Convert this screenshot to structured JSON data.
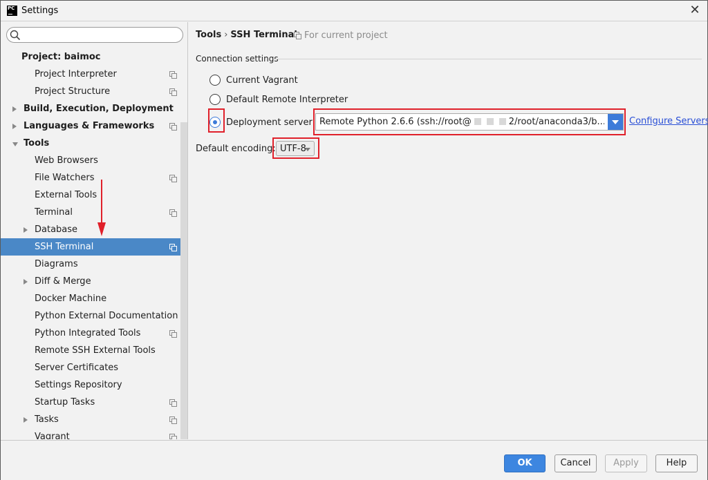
{
  "window": {
    "title": "Settings",
    "app_icon_text": "PC"
  },
  "search": {
    "placeholder": "",
    "icon": "search-icon"
  },
  "sidebar": {
    "items": [
      {
        "label": "Project: baimoc",
        "indent": 30,
        "bold": true,
        "arrow": "none",
        "copy": false,
        "selected": false
      },
      {
        "label": "Project Interpreter",
        "indent": 49,
        "bold": false,
        "arrow": "none",
        "copy": true,
        "selected": false
      },
      {
        "label": "Project Structure",
        "indent": 49,
        "bold": false,
        "arrow": "none",
        "copy": true,
        "selected": false
      },
      {
        "label": "Build, Execution, Deployment",
        "indent": 33,
        "bold": true,
        "arrow": "right",
        "copy": false,
        "selected": false
      },
      {
        "label": "Languages & Frameworks",
        "indent": 33,
        "bold": true,
        "arrow": "right",
        "copy": true,
        "selected": false
      },
      {
        "label": "Tools",
        "indent": 33,
        "bold": true,
        "arrow": "down",
        "copy": false,
        "selected": false
      },
      {
        "label": "Web Browsers",
        "indent": 49,
        "bold": false,
        "arrow": "none",
        "copy": false,
        "selected": false
      },
      {
        "label": "File Watchers",
        "indent": 49,
        "bold": false,
        "arrow": "none",
        "copy": true,
        "selected": false
      },
      {
        "label": "External Tools",
        "indent": 49,
        "bold": false,
        "arrow": "none",
        "copy": false,
        "selected": false
      },
      {
        "label": "Terminal",
        "indent": 49,
        "bold": false,
        "arrow": "none",
        "copy": true,
        "selected": false
      },
      {
        "label": "Database",
        "indent": 49,
        "bold": false,
        "arrow": "right",
        "copy": false,
        "selected": false
      },
      {
        "label": "SSH Terminal",
        "indent": 49,
        "bold": false,
        "arrow": "none",
        "copy": true,
        "selected": true
      },
      {
        "label": "Diagrams",
        "indent": 49,
        "bold": false,
        "arrow": "none",
        "copy": false,
        "selected": false
      },
      {
        "label": "Diff & Merge",
        "indent": 49,
        "bold": false,
        "arrow": "right",
        "copy": false,
        "selected": false
      },
      {
        "label": "Docker Machine",
        "indent": 49,
        "bold": false,
        "arrow": "none",
        "copy": false,
        "selected": false
      },
      {
        "label": "Python External Documentation",
        "indent": 49,
        "bold": false,
        "arrow": "none",
        "copy": false,
        "selected": false
      },
      {
        "label": "Python Integrated Tools",
        "indent": 49,
        "bold": false,
        "arrow": "none",
        "copy": true,
        "selected": false
      },
      {
        "label": "Remote SSH External Tools",
        "indent": 49,
        "bold": false,
        "arrow": "none",
        "copy": false,
        "selected": false
      },
      {
        "label": "Server Certificates",
        "indent": 49,
        "bold": false,
        "arrow": "none",
        "copy": false,
        "selected": false
      },
      {
        "label": "Settings Repository",
        "indent": 49,
        "bold": false,
        "arrow": "none",
        "copy": false,
        "selected": false
      },
      {
        "label": "Startup Tasks",
        "indent": 49,
        "bold": false,
        "arrow": "none",
        "copy": true,
        "selected": false
      },
      {
        "label": "Tasks",
        "indent": 49,
        "bold": false,
        "arrow": "right",
        "copy": true,
        "selected": false
      },
      {
        "label": "Vagrant",
        "indent": 49,
        "bold": false,
        "arrow": "none",
        "copy": true,
        "selected": false
      }
    ]
  },
  "content": {
    "breadcrumb": {
      "parent": "Tools",
      "separator": "›",
      "current": "SSH Terminal"
    },
    "for_project": "For current project",
    "group_label": "Connection settings",
    "radios": [
      {
        "label": "Current Vagrant",
        "checked": false
      },
      {
        "label": "Default Remote Interpreter",
        "checked": false
      },
      {
        "label": "Deployment server",
        "checked": true
      }
    ],
    "server_combo": {
      "prefix": "Remote Python 2.6.6 (ssh://root@",
      "suffix": "2/root/anaconda3/b..."
    },
    "configure_link": "Configure Servers",
    "encoding_label": "Default encoding:",
    "encoding_value": "UTF-8"
  },
  "footer": {
    "ok": "OK",
    "cancel": "Cancel",
    "apply": "Apply",
    "help": "Help"
  },
  "colors": {
    "selection": "#4a88c7",
    "accent": "#3d7bd9",
    "annotation": "#e0202a",
    "link": "#2a4fd6"
  }
}
